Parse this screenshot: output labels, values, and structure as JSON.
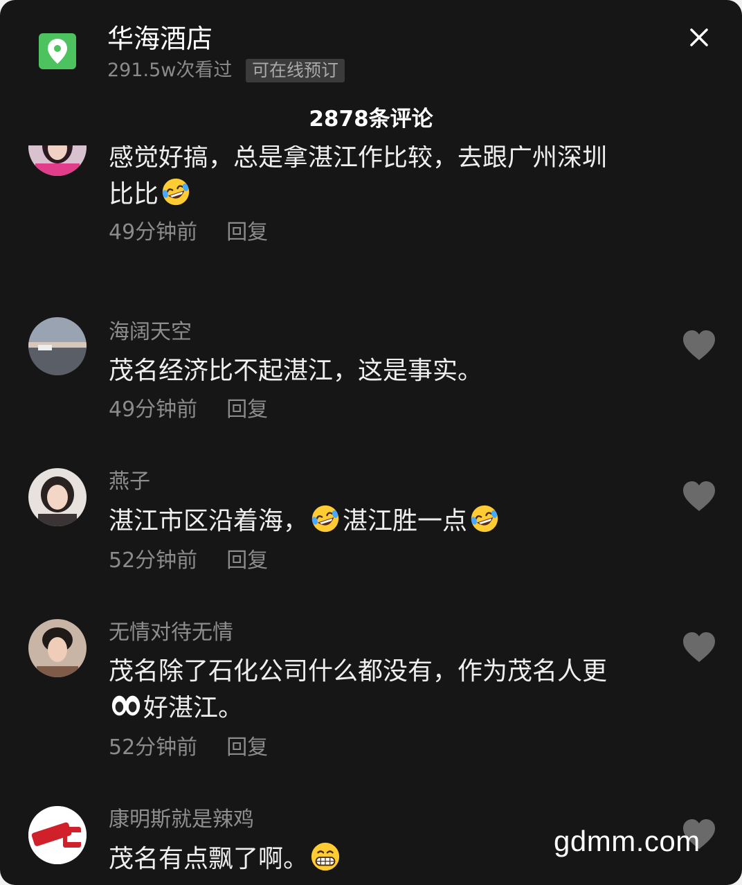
{
  "poi": {
    "title": "华海酒店",
    "views": "291.5w次看过",
    "badge": "可在线预订"
  },
  "comment_count": "2878条评论",
  "comments": [
    {
      "username": "",
      "text_lines": [
        "感觉好搞，总是拿湛江作比较，去跟广州深圳",
        "比比"
      ],
      "time": "49分钟前",
      "reply": "回复"
    },
    {
      "username": "海阔天空",
      "text_parts": [
        "茂名经济比不起湛江，这是事实。"
      ],
      "time": "49分钟前",
      "reply": "回复"
    },
    {
      "username": "燕子",
      "text_parts": [
        "湛江市区沿着海，",
        "湛江胜一点"
      ],
      "time": "52分钟前",
      "reply": "回复"
    },
    {
      "username": "无情对待无情",
      "text_lines": [
        "茂名除了石化公司什么都没有，作为茂名人更",
        "好湛江。"
      ],
      "time": "52分钟前",
      "reply": "回复"
    },
    {
      "username": "康明斯就是辣鸡",
      "text_parts": [
        "茂名有点飘了啊。"
      ],
      "avatar_logo_text": "Cummins"
    }
  ],
  "icons": {
    "location": "map-pin-icon",
    "close": "close-icon",
    "like": "heart-icon",
    "emoji_laugh": "rolling-on-floor-laughing-emoji",
    "emoji_eyes": "eyes-emoji",
    "emoji_grin": "grinning-emoji"
  },
  "watermark": "gdmm.com",
  "colors": {
    "background": "#161616",
    "accent_green": "#4cc35f",
    "text_primary": "#efefef",
    "text_secondary": "#8b8b8b"
  }
}
